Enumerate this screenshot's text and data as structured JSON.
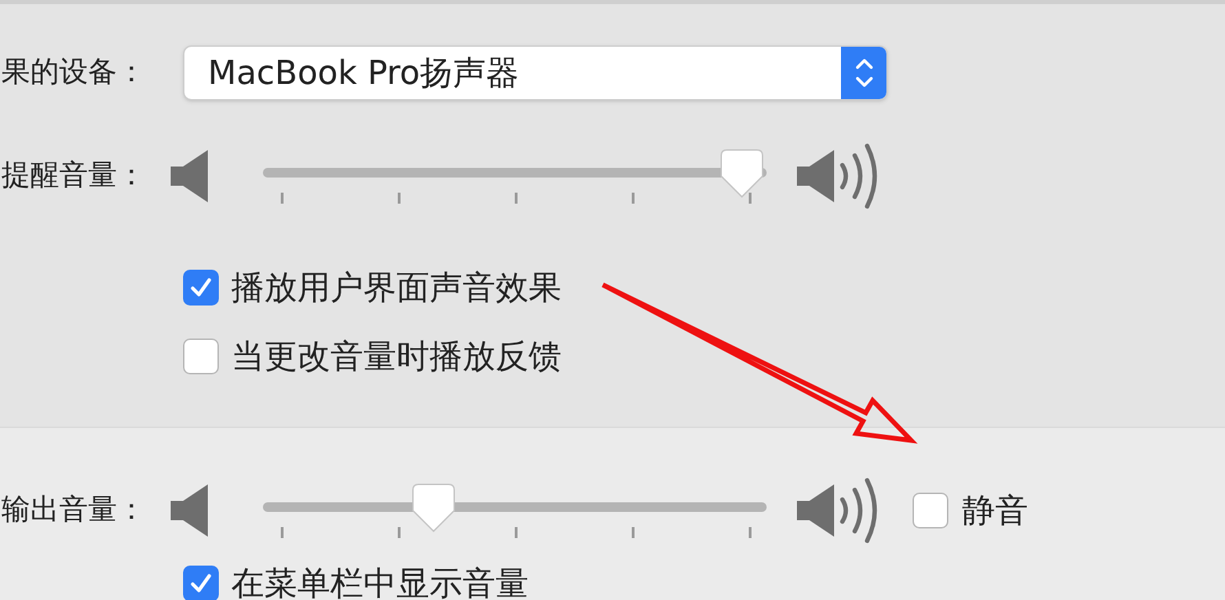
{
  "output_device": {
    "label": "果的设备：",
    "value": "MacBook Pro扬声器"
  },
  "alert_volume": {
    "label": "提醒音量：",
    "level": 0.95
  },
  "options": [
    {
      "label": "播放用户界面声音效果",
      "checked": true
    },
    {
      "label": "当更改音量时播放反馈",
      "checked": false
    }
  ],
  "output_volume": {
    "label": "输出音量：",
    "level": 0.34,
    "mute": {
      "label": "静音",
      "checked": false
    }
  },
  "menu_bar_option": {
    "label": "在菜单栏中显示音量",
    "checked": true
  }
}
